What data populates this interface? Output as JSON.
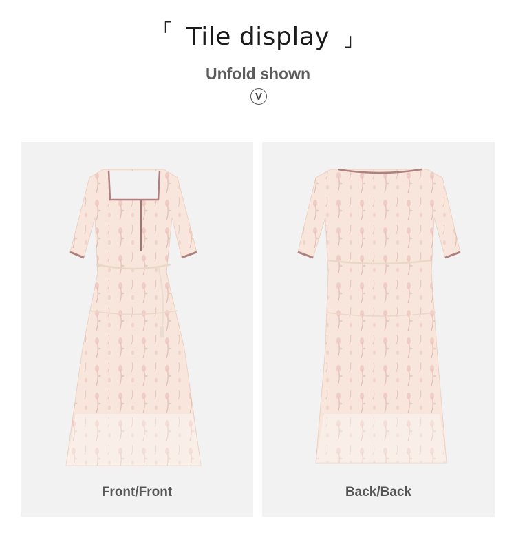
{
  "header": {
    "open_bracket": "「",
    "title": "Tile display",
    "close_bracket": "」",
    "subtitle": "Unfold shown",
    "expand_icon_glyph": "V"
  },
  "panels": [
    {
      "caption": "Front/Front",
      "image": "dress-front-image"
    },
    {
      "caption": "Back/Back",
      "image": "dress-back-image"
    }
  ],
  "colors": {
    "panel_bg": "#f2f2f2",
    "dress": "#f8e6dc",
    "trim": "#b08080",
    "print": "#d9a3a0"
  }
}
